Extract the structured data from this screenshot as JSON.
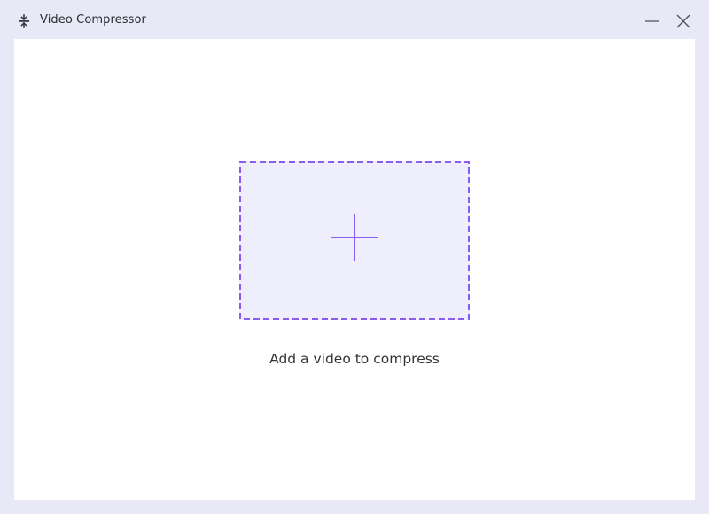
{
  "window": {
    "title": "Video Compressor",
    "app_icon": "compress-arrows-icon",
    "controls": {
      "minimize_icon": "minimize-icon",
      "close_icon": "close-icon"
    }
  },
  "main": {
    "dropzone": {
      "icon": "plus-icon",
      "accent_color": "#8a5cf0",
      "fill_color": "#efeefc"
    },
    "hint_text": "Add a video to compress"
  },
  "colors": {
    "frame": "#e8e8f6",
    "content": "#ffffff"
  }
}
